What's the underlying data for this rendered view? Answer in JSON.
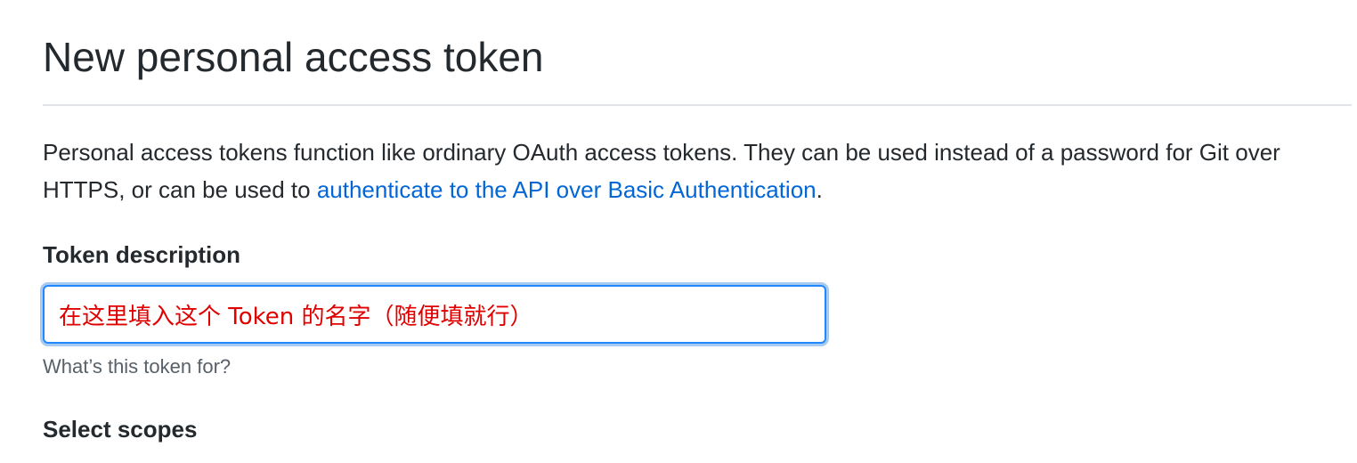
{
  "page": {
    "title": "New personal access token"
  },
  "intro": {
    "text_before_link": "Personal access tokens function like ordinary OAuth access tokens. They can be used instead of a password for Git over HTTPS, or can be used to ",
    "link_text": "authenticate to the API over Basic Authentication",
    "text_after_link": "."
  },
  "token_description": {
    "label": "Token description",
    "value": "在这里填入这个 Token 的名字（随便填就行）",
    "hint": "What’s this token for?"
  },
  "scopes": {
    "label": "Select scopes"
  },
  "colors": {
    "text": "#24292e",
    "link": "#0366d6",
    "input_border": "#2188ff",
    "input_value": "#e00000",
    "hint": "#586069",
    "divider": "#e1e4e8"
  }
}
